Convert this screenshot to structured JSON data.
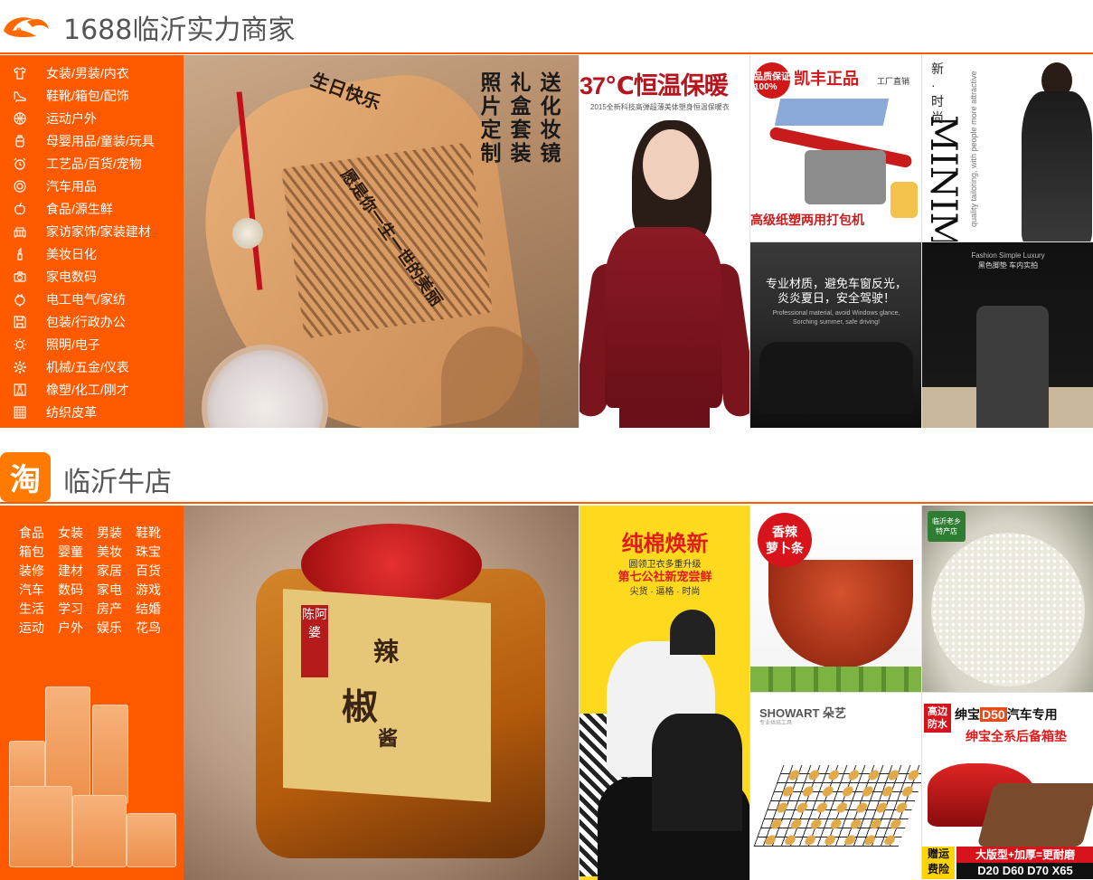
{
  "section1": {
    "title": "1688临沂实力商家",
    "logo_icon": "alibaba-1688-logo-icon",
    "categories": [
      {
        "label": "女装/男装/内衣",
        "icon": "tshirt-icon"
      },
      {
        "label": "鞋靴/箱包/配饰",
        "icon": "high-heel-icon"
      },
      {
        "label": "运动户外",
        "icon": "basketball-icon"
      },
      {
        "label": "母婴用品/童装/玩具",
        "icon": "baby-bottle-icon"
      },
      {
        "label": "工艺品/百货/宠物",
        "icon": "alarm-clock-icon"
      },
      {
        "label": "汽车用品",
        "icon": "steering-wheel-icon"
      },
      {
        "label": "食品/源生鲜",
        "icon": "apple-icon"
      },
      {
        "label": "家访家饰/家装建材",
        "icon": "sofa-icon"
      },
      {
        "label": "美妆日化",
        "icon": "lipstick-icon"
      },
      {
        "label": "家电数码",
        "icon": "camera-icon"
      },
      {
        "label": "电工电气/家纺",
        "icon": "plug-icon"
      },
      {
        "label": "包装/行政办公",
        "icon": "floppy-disk-icon"
      },
      {
        "label": "照明/电子",
        "icon": "lightbulb-icon"
      },
      {
        "label": "机械/五金/仪表",
        "icon": "gear-icon"
      },
      {
        "label": "橡塑/化工/刚才",
        "icon": "flask-box-icon"
      },
      {
        "label": "纺织皮革",
        "icon": "fabric-icon"
      }
    ],
    "tiles": {
      "comb": {
        "vertical_text_1": "送化妆镜",
        "vertical_text_2": "礼盒套装",
        "vertical_text_3": "照片定制",
        "engrave_brand": "生日快乐",
        "engrave_text": "愿是你一生一世的美丽"
      },
      "sweater": {
        "title": "37℃恒温保暖",
        "subtitle": "2015全新科技高弹超薄美体塑身恒温保暖衣"
      },
      "tool": {
        "badge": "品质保证 100%",
        "brand": "凯丰正品",
        "brand_small": "工厂直销",
        "footer": "高级纸塑两用打包机"
      },
      "fashion": {
        "logo": "新·时尚",
        "big_text": "MINIMALIST",
        "en_text": "quality tailoring, with people more attractive"
      },
      "dash": {
        "line1": "专业材质，避免车窗反光，",
        "line2": "炎炎夏日，安全驾驶！",
        "en1": "Professional material, avoid Windows glance,",
        "en2": "Sorching summer, safe driving!"
      },
      "mat": {
        "caption": "Fashion Simple Luxury",
        "caption2": "黑色脚垫  车内实拍"
      }
    }
  },
  "section2": {
    "title": "临沂牛店",
    "logo_text": "淘",
    "tags": [
      "食品",
      "女装",
      "男装",
      "鞋靴",
      "箱包",
      "婴童",
      "美妆",
      "珠宝",
      "装修",
      "建材",
      "家居",
      "百货",
      "汽车",
      "数码",
      "家电",
      "游戏",
      "生活",
      "学习",
      "房产",
      "结婚",
      "运动",
      "户外",
      "娱乐",
      "花鸟"
    ],
    "tiles": {
      "jar": {
        "stamp": "陈阿婆",
        "char1": "辣",
        "char2": "椒",
        "char3": "酱"
      },
      "cotton": {
        "title": "纯棉焕新",
        "sub1": "圆领卫衣多重升级",
        "sub2": "第七公社新宠尝鲜",
        "sub3": "尖货 · 逼格 · 时尚"
      },
      "radish": {
        "badge_line1": "香辣",
        "badge_line2": "萝卜条"
      },
      "rice": {
        "badge_line1": "临沂老乡",
        "badge_line2": "特产店"
      },
      "cookies": {
        "brand": "SHOWART 朵艺",
        "sub": "专业烘焙工具"
      },
      "carmat": {
        "tag_line1": "高边",
        "tag_line2": "防水",
        "title_pre": "绅宝",
        "title_hl": "D50",
        "title_post": "汽车专用",
        "title2": "绅宝全系后备箱垫",
        "foot_tag_line1": "赠运",
        "foot_tag_line2": "费险",
        "foot_line1": "大版型+加厚=更耐磨",
        "foot_line2": "D20 D60 D70 X65"
      }
    }
  },
  "colors": {
    "accent": "#ff5a00",
    "title_gray": "#555555",
    "taobao_orange": "#ff7a00"
  }
}
